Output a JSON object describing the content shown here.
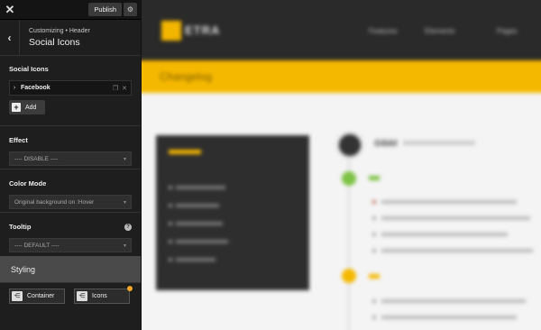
{
  "topbar": {
    "close_icon": "close-icon",
    "publish_label": "Publish",
    "gear_icon": "gear-icon"
  },
  "header": {
    "back_icon": "chevron-left-icon",
    "breadcrumb": "Customizing • Header",
    "title": "Social Icons"
  },
  "social_icons": {
    "label": "Social Icons",
    "items": [
      {
        "label": "Facebook"
      }
    ],
    "add_label": "Add"
  },
  "effect": {
    "label": "Effect",
    "value": "---- DISABLE ----"
  },
  "color_mode": {
    "label": "Color Mode",
    "value": "Original background on :Hover"
  },
  "tooltip": {
    "label": "Tooltip",
    "value": "---- DEFAULT ----",
    "help_icon": "help-icon"
  },
  "styling": {
    "label": "Styling",
    "buttons": [
      {
        "label": "Container"
      },
      {
        "label": "Icons"
      }
    ],
    "indicator_color": "#f5a623"
  },
  "preview": {
    "accent_color": "#f5b800",
    "logo_text": "ETRA",
    "band_text": "Changelog",
    "post_title": "Gibbl",
    "nav": [
      "Features",
      "Elements",
      "Pages"
    ]
  }
}
